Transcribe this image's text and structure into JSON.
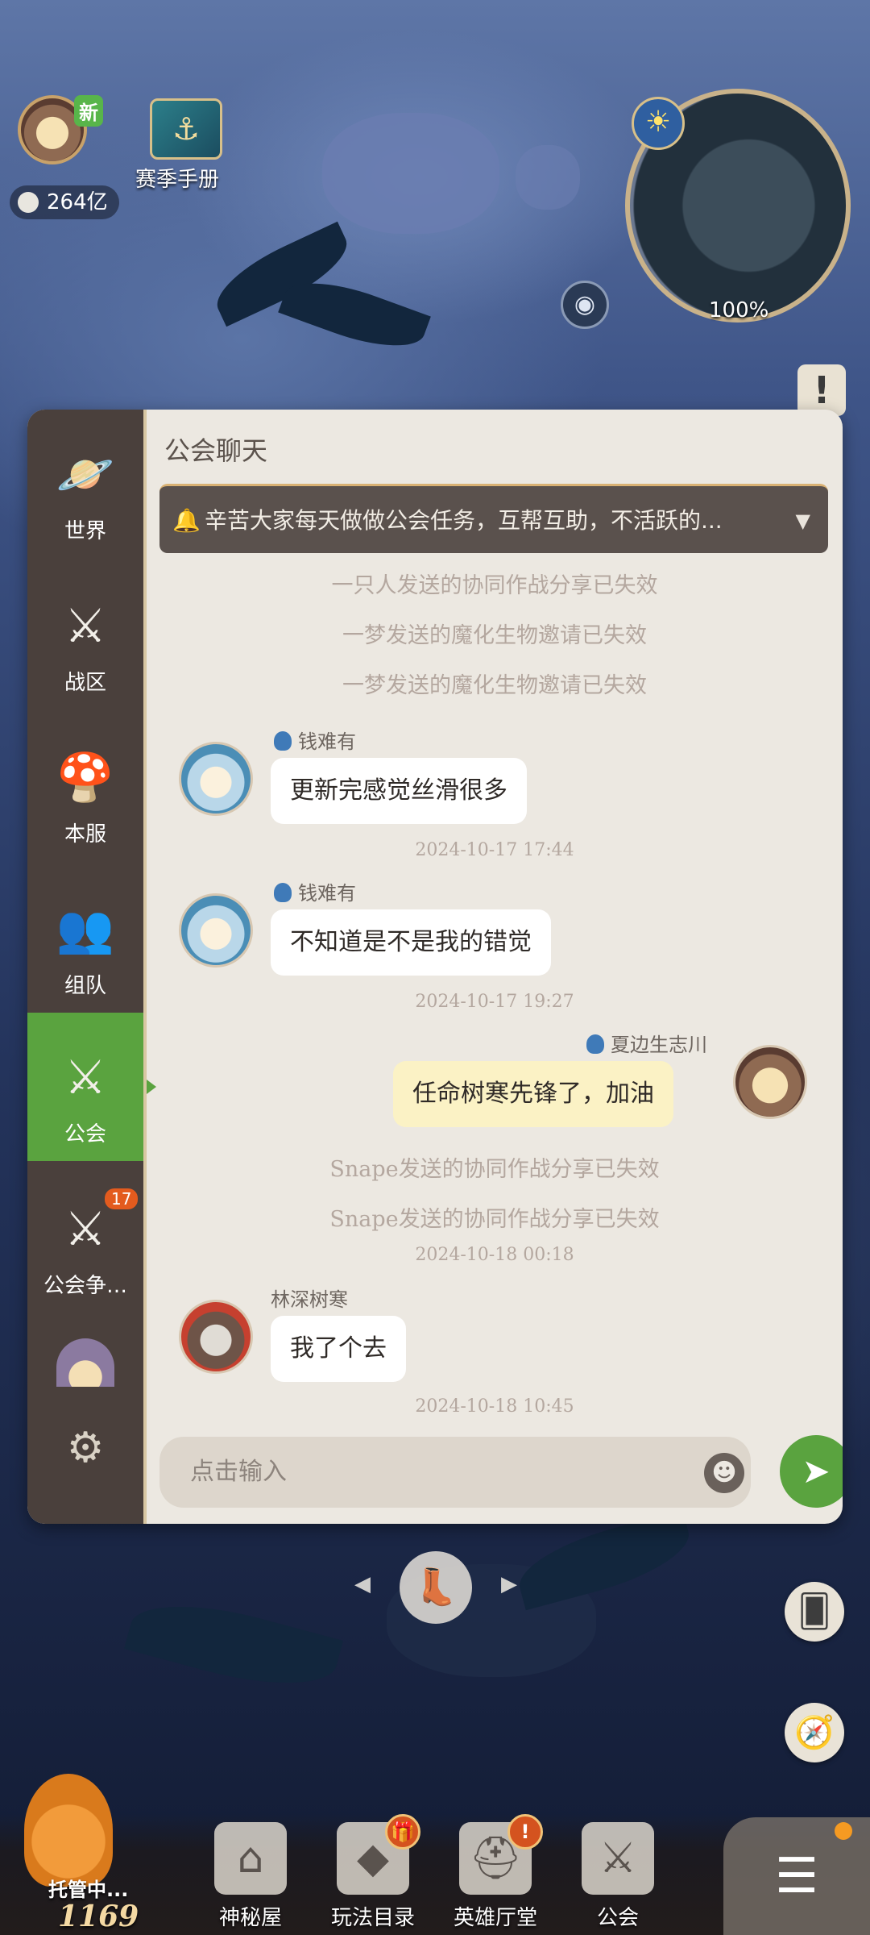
{
  "hud": {
    "badge_new": "新",
    "currency_value": "264亿",
    "season_label": "赛季手册",
    "minimap_percent": "100%",
    "season_icon": "anchor-icon",
    "minimap_sun_icon": "sun-moon-icon",
    "eye_icon": "eye-icon",
    "alert_text": "!"
  },
  "sidebar": {
    "items": [
      {
        "label": "世界",
        "icon": "planet-icon",
        "glyph": "🪐"
      },
      {
        "label": "战区",
        "icon": "crossed-swords-icon",
        "glyph": "⚔"
      },
      {
        "label": "本服",
        "icon": "mushroom-icon",
        "glyph": "🍄"
      },
      {
        "label": "组队",
        "icon": "team-icon",
        "glyph": "👥"
      },
      {
        "label": "公会",
        "icon": "guild-icon",
        "glyph": "⚔"
      },
      {
        "label": "公会争…",
        "icon": "guild-war-icon",
        "glyph": "⚔",
        "badge": "17"
      }
    ],
    "active_index": 4
  },
  "chat": {
    "title": "公会聊天",
    "notice": "辛苦大家每天做做公会任务，互帮互助，不活跃的...",
    "sys_1": "一只人发送的协同作战分享已失效",
    "sys_2": "一梦发送的魔化生物邀请已失效",
    "sys_3": "一梦发送的魔化生物邀请已失效",
    "msg1": {
      "sender": "钱难有",
      "text": "更新完感觉丝滑很多",
      "time": "2024-10-17 17:44"
    },
    "msg2": {
      "sender": "钱难有",
      "text": "不知道是不是我的错觉",
      "time": "2024-10-17 19:27"
    },
    "msg3": {
      "sender": "夏边生志川",
      "text": "任命树寒先锋了，加油"
    },
    "sys_4": "Snape发送的协同作战分享已失效",
    "sys_5": "Snape发送的协同作战分享已失效",
    "time_4": "2024-10-18 00:18",
    "msg4": {
      "sender": "林深树寒",
      "text": "我了个去",
      "time": "2024-10-18 10:45"
    },
    "input_placeholder": "点击输入"
  },
  "bottom_nav": {
    "auto_label": "托管中...",
    "auto_number": "1169",
    "items": [
      {
        "label": "神秘屋",
        "icon": "mystery-house-icon",
        "glyph": "⌂"
      },
      {
        "label": "玩法目录",
        "icon": "gameplay-catalog-icon",
        "glyph": "◆",
        "badge": "🎁"
      },
      {
        "label": "英雄厅堂",
        "icon": "hero-helmet-icon",
        "glyph": "⛑",
        "badge": "!"
      },
      {
        "label": "公会",
        "icon": "guild-icon",
        "glyph": "⚔"
      }
    ]
  },
  "colors": {
    "active_green": "#5aa33f",
    "panel_bg": "#ece8e1",
    "sidebar_bg": "#4a403c",
    "own_bubble": "#fbf2c5"
  }
}
